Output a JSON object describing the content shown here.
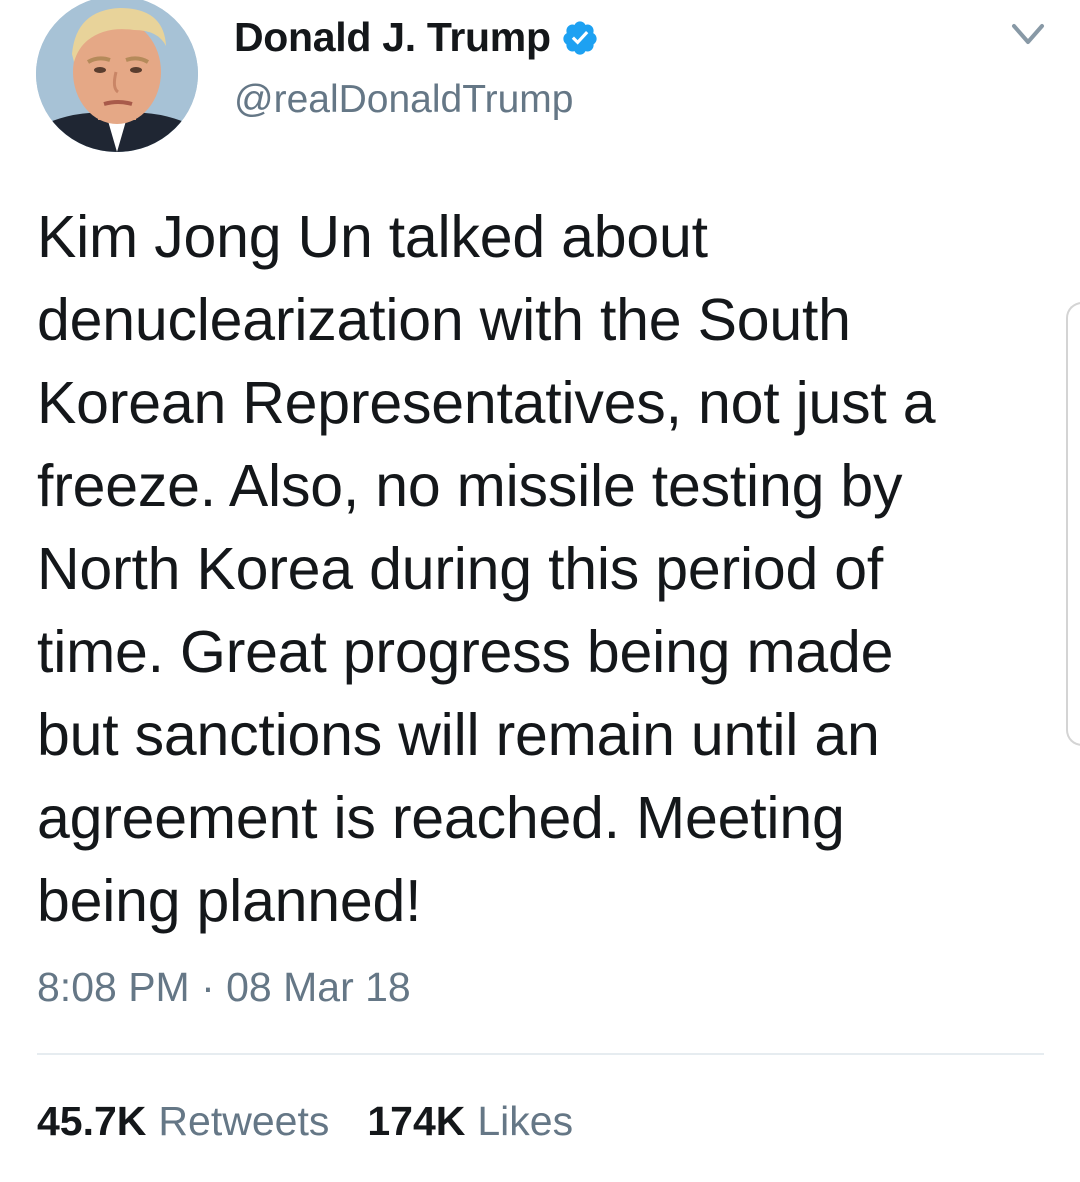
{
  "user": {
    "display_name": "Donald J. Trump",
    "handle": "@realDonaldTrump",
    "verified_icon": "verified-badge-icon",
    "verified_color": "#1da1f2"
  },
  "menu": {
    "icon": "chevron-down-icon"
  },
  "tweet": {
    "text": "Kim Jong Un talked about\ndenuclearization with the South\nKorean Representatives, not just a\nfreeze. Also, no missile testing by\nNorth Korea during this period of\ntime. Great progress being made\nbut sanctions will remain until an\nagreement is reached. Meeting\nbeing planned!",
    "timestamp": "8:08 PM · 08 Mar 18"
  },
  "stats": {
    "retweets_count": "45.7K",
    "retweets_label": "Retweets",
    "likes_count": "174K",
    "likes_label": "Likes"
  },
  "colors": {
    "text": "#14171a",
    "secondary": "#657786",
    "divider": "#e6ecf0"
  }
}
